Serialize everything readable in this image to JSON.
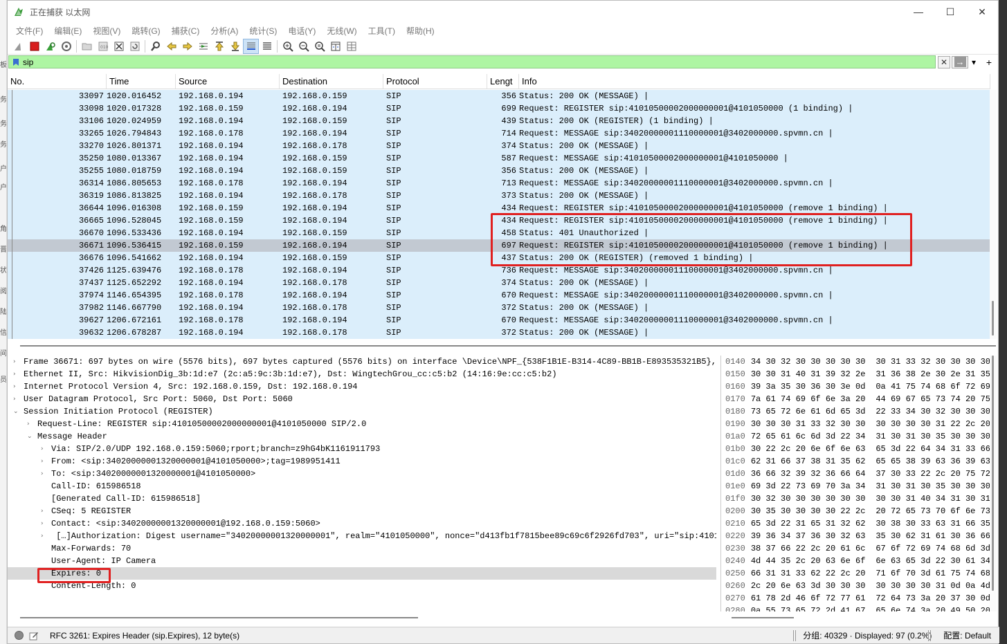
{
  "window": {
    "title": "正在捕获 以太网",
    "minimize": "—",
    "maximize": "☐",
    "close": "✕"
  },
  "menu": [
    "文件(F)",
    "编辑(E)",
    "视图(V)",
    "跳转(G)",
    "捕获(C)",
    "分析(A)",
    "统计(S)",
    "电话(Y)",
    "无线(W)",
    "工具(T)",
    "帮助(H)"
  ],
  "toolbar_icons": [
    "shark-fin-start-icon",
    "stop-icon",
    "restart-icon",
    "options-icon",
    "open-file-icon",
    "save-icon",
    "close-file-icon",
    "reload-icon",
    "find-icon",
    "back-icon",
    "forward-icon",
    "goto-icon",
    "first-icon",
    "last-icon",
    "autoscroll-icon",
    "colorize-icon",
    "zoom-in-icon",
    "zoom-out-icon",
    "zoom-normal-icon",
    "resize-columns-icon",
    "layout-icon"
  ],
  "filter": {
    "value": "sip",
    "clear": "✕",
    "apply": "→",
    "dropdown": "▾",
    "add": "+"
  },
  "packet_columns": [
    "No.",
    "Time",
    "Source",
    "Destination",
    "Protocol",
    "Lengt",
    "Info"
  ],
  "packets": [
    {
      "no": "33097",
      "time": "1020.016452",
      "src": "192.168.0.194",
      "dst": "192.168.0.159",
      "proto": "SIP",
      "len": "356",
      "info": "Status: 200 OK (MESSAGE) |"
    },
    {
      "no": "33098",
      "time": "1020.017328",
      "src": "192.168.0.159",
      "dst": "192.168.0.194",
      "proto": "SIP",
      "len": "699",
      "info": "Request: REGISTER sip:41010500002000000001@4101050000  (1 binding) |"
    },
    {
      "no": "33106",
      "time": "1020.024959",
      "src": "192.168.0.194",
      "dst": "192.168.0.159",
      "proto": "SIP",
      "len": "439",
      "info": "Status: 200 OK (REGISTER)  (1 binding) |"
    },
    {
      "no": "33265",
      "time": "1026.794843",
      "src": "192.168.0.178",
      "dst": "192.168.0.194",
      "proto": "SIP",
      "len": "714",
      "info": "Request: MESSAGE sip:34020000001110000001@3402000000.spvmn.cn |"
    },
    {
      "no": "33270",
      "time": "1026.801371",
      "src": "192.168.0.194",
      "dst": "192.168.0.178",
      "proto": "SIP",
      "len": "374",
      "info": "Status: 200 OK (MESSAGE) |"
    },
    {
      "no": "35250",
      "time": "1080.013367",
      "src": "192.168.0.194",
      "dst": "192.168.0.159",
      "proto": "SIP",
      "len": "587",
      "info": "Request: MESSAGE sip:41010500002000000001@4101050000 |"
    },
    {
      "no": "35255",
      "time": "1080.018759",
      "src": "192.168.0.194",
      "dst": "192.168.0.159",
      "proto": "SIP",
      "len": "356",
      "info": "Status: 200 OK (MESSAGE) |"
    },
    {
      "no": "36314",
      "time": "1086.805653",
      "src": "192.168.0.178",
      "dst": "192.168.0.194",
      "proto": "SIP",
      "len": "713",
      "info": "Request: MESSAGE sip:34020000001110000001@3402000000.spvmn.cn |"
    },
    {
      "no": "36319",
      "time": "1086.813825",
      "src": "192.168.0.194",
      "dst": "192.168.0.178",
      "proto": "SIP",
      "len": "373",
      "info": "Status: 200 OK (MESSAGE) |"
    },
    {
      "no": "36644",
      "time": "1096.016308",
      "src": "192.168.0.159",
      "dst": "192.168.0.194",
      "proto": "SIP",
      "len": "434",
      "info": "Request: REGISTER sip:41010500002000000001@4101050000  (remove 1 binding) |"
    },
    {
      "no": "36665",
      "time": "1096.528045",
      "src": "192.168.0.159",
      "dst": "192.168.0.194",
      "proto": "SIP",
      "len": "434",
      "info": "Request: REGISTER sip:41010500002000000001@4101050000  (remove 1 binding) |"
    },
    {
      "no": "36670",
      "time": "1096.533436",
      "src": "192.168.0.194",
      "dst": "192.168.0.159",
      "proto": "SIP",
      "len": "458",
      "info": "Status: 401 Unauthorized |"
    },
    {
      "no": "36671",
      "time": "1096.536415",
      "src": "192.168.0.159",
      "dst": "192.168.0.194",
      "proto": "SIP",
      "len": "697",
      "info": "Request: REGISTER sip:41010500002000000001@4101050000  (remove 1 binding) |",
      "selected": true
    },
    {
      "no": "36676",
      "time": "1096.541662",
      "src": "192.168.0.194",
      "dst": "192.168.0.159",
      "proto": "SIP",
      "len": "437",
      "info": "Status: 200 OK (REGISTER)  (removed 1 binding) |"
    },
    {
      "no": "37426",
      "time": "1125.639476",
      "src": "192.168.0.178",
      "dst": "192.168.0.194",
      "proto": "SIP",
      "len": "736",
      "info": "Request: MESSAGE sip:34020000001110000001@3402000000.spvmn.cn |"
    },
    {
      "no": "37437",
      "time": "1125.652292",
      "src": "192.168.0.194",
      "dst": "192.168.0.178",
      "proto": "SIP",
      "len": "374",
      "info": "Status: 200 OK (MESSAGE) |"
    },
    {
      "no": "37974",
      "time": "1146.654395",
      "src": "192.168.0.178",
      "dst": "192.168.0.194",
      "proto": "SIP",
      "len": "670",
      "info": "Request: MESSAGE sip:34020000001110000001@3402000000.spvmn.cn |"
    },
    {
      "no": "37982",
      "time": "1146.667790",
      "src": "192.168.0.194",
      "dst": "192.168.0.178",
      "proto": "SIP",
      "len": "372",
      "info": "Status: 200 OK (MESSAGE) |"
    },
    {
      "no": "39627",
      "time": "1206.672161",
      "src": "192.168.0.178",
      "dst": "192.168.0.194",
      "proto": "SIP",
      "len": "670",
      "info": "Request: MESSAGE sip:34020000001110000001@3402000000.spvmn.cn |"
    },
    {
      "no": "39632",
      "time": "1206.678287",
      "src": "192.168.0.194",
      "dst": "192.168.0.178",
      "proto": "SIP",
      "len": "372",
      "info": "Status: 200 OK (MESSAGE) |"
    }
  ],
  "details": [
    {
      "level": 0,
      "arrow": "›",
      "text": "Frame 36671: 697 bytes on wire (5576 bits), 697 bytes captured (5576 bits) on interface \\Device\\NPF_{538F1B1E-B314-4C89-BB1B-E893535321B5},"
    },
    {
      "level": 0,
      "arrow": "›",
      "text": "Ethernet II, Src: HikvisionDig_3b:1d:e7 (2c:a5:9c:3b:1d:e7), Dst: WingtechGrou_cc:c5:b2 (14:16:9e:cc:c5:b2)"
    },
    {
      "level": 0,
      "arrow": "›",
      "text": "Internet Protocol Version 4, Src: 192.168.0.159, Dst: 192.168.0.194"
    },
    {
      "level": 0,
      "arrow": "›",
      "text": "User Datagram Protocol, Src Port: 5060, Dst Port: 5060"
    },
    {
      "level": 0,
      "arrow": "⌄",
      "text": "Session Initiation Protocol (REGISTER)"
    },
    {
      "level": 1,
      "arrow": "›",
      "text": "Request-Line: REGISTER sip:41010500002000000001@4101050000 SIP/2.0"
    },
    {
      "level": 1,
      "arrow": "⌄",
      "text": "Message Header"
    },
    {
      "level": 2,
      "arrow": "›",
      "text": "Via: SIP/2.0/UDP 192.168.0.159:5060;rport;branch=z9hG4bK1161911793"
    },
    {
      "level": 2,
      "arrow": "›",
      "text": "From: <sip:34020000001320000001@4101050000>;tag=1989951411"
    },
    {
      "level": 2,
      "arrow": "›",
      "text": "To: <sip:34020000001320000001@4101050000>"
    },
    {
      "level": 2,
      "arrow": "",
      "text": "Call-ID: 615986518"
    },
    {
      "level": 2,
      "arrow": "",
      "text": "[Generated Call-ID: 615986518]"
    },
    {
      "level": 2,
      "arrow": "›",
      "text": "CSeq: 5 REGISTER"
    },
    {
      "level": 2,
      "arrow": "›",
      "text": "Contact: <sip:34020000001320000001@192.168.0.159:5060>"
    },
    {
      "level": 2,
      "arrow": "›",
      "text": " […]Authorization: Digest username=\"34020000001320000001\", realm=\"4101050000\", nonce=\"d413fb1f7815bee89c69c6f2926fd703\", uri=\"sip:41010"
    },
    {
      "level": 2,
      "arrow": "",
      "text": "Max-Forwards: 70"
    },
    {
      "level": 2,
      "arrow": "",
      "text": "User-Agent: IP Camera"
    },
    {
      "level": 2,
      "arrow": "",
      "text": "Expires: 0",
      "selected": true
    },
    {
      "level": 2,
      "arrow": "",
      "text": "Content-Length: 0"
    }
  ],
  "hex": [
    {
      "off": "0140",
      "a": "34 30 32 30 30 30 30 30",
      "b": "30 31 33 32 30 30 30 30"
    },
    {
      "off": "0150",
      "a": "30 30 31 40 31 39 32 2e",
      "b": "31 36 38 2e 30 2e 31 35"
    },
    {
      "off": "0160",
      "a": "39 3a 35 30 36 30 3e 0d",
      "b": "0a 41 75 74 68 6f 72 69"
    },
    {
      "off": "0170",
      "a": "7a 61 74 69 6f 6e 3a 20",
      "b": "44 69 67 65 73 74 20 75"
    },
    {
      "off": "0180",
      "a": "73 65 72 6e 61 6d 65 3d",
      "b": "22 33 34 30 32 30 30 30"
    },
    {
      "off": "0190",
      "a": "30 30 30 31 33 32 30 30",
      "b": "30 30 30 30 31 22 2c 20"
    },
    {
      "off": "01a0",
      "a": "72 65 61 6c 6d 3d 22 34",
      "b": "31 30 31 30 35 30 30 30"
    },
    {
      "off": "01b0",
      "a": "30 22 2c 20 6e 6f 6e 63",
      "b": "65 3d 22 64 34 31 33 66"
    },
    {
      "off": "01c0",
      "a": "62 31 66 37 38 31 35 62",
      "b": "65 65 38 39 63 36 39 63"
    },
    {
      "off": "01d0",
      "a": "36 66 32 39 32 36 66 64",
      "b": "37 30 33 22 2c 20 75 72"
    },
    {
      "off": "01e0",
      "a": "69 3d 22 73 69 70 3a 34",
      "b": "31 30 31 30 35 30 30 30"
    },
    {
      "off": "01f0",
      "a": "30 32 30 30 30 30 30 30",
      "b": "30 30 31 40 34 31 30 31"
    },
    {
      "off": "0200",
      "a": "30 35 30 30 30 30 22 2c",
      "b": "20 72 65 73 70 6f 6e 73"
    },
    {
      "off": "0210",
      "a": "65 3d 22 31 65 31 32 62",
      "b": "30 38 30 33 63 31 66 35"
    },
    {
      "off": "0220",
      "a": "39 36 34 37 36 30 32 63",
      "b": "35 30 62 31 61 30 36 66"
    },
    {
      "off": "0230",
      "a": "38 37 66 22 2c 20 61 6c",
      "b": "67 6f 72 69 74 68 6d 3d"
    },
    {
      "off": "0240",
      "a": "4d 44 35 2c 20 63 6e 6f",
      "b": "6e 63 65 3d 22 30 61 34"
    },
    {
      "off": "0250",
      "a": "66 31 31 33 62 22 2c 20",
      "b": "71 6f 70 3d 61 75 74 68"
    },
    {
      "off": "0260",
      "a": "2c 20 6e 63 3d 30 30 30",
      "b": "30 30 30 30 31 0d 0a 4d"
    },
    {
      "off": "0270",
      "a": "61 78 2d 46 6f 72 77 61",
      "b": "72 64 73 3a 20 37 30 0d"
    },
    {
      "off": "0280",
      "a": "0a 55 73 65 72 2d 41 67",
      "b": "65 6e 74 3a 20 49 50 20"
    },
    {
      "off": "0290",
      "a": "43 61 6d 65 72 61 0d 0a",
      "b": "45 78 70 69 72 65 73 3a"
    },
    {
      "off": "02a0",
      "a": "20 30 0d 0a 43 6f 6e 74",
      "b": "65 6e 74 2d 4c 65 6e 67"
    },
    {
      "off": "02b0",
      "a": "74 68 3a 20 30 0d 0a 0d",
      "b": "0a"
    }
  ],
  "status": {
    "field_text": "RFC 3261: Expires Header (sip.Expires), 12 byte(s)",
    "packets_text": "分组: 40329 · Displayed: 97 (0.2%)",
    "profile_text": "配置: Default"
  },
  "left_strip_chars": [
    "板",
    "务",
    "务",
    "务",
    "户",
    "户",
    "角",
    "晋",
    "状",
    "阅",
    "陆",
    "信",
    "间",
    "员"
  ],
  "colors": {
    "row_bg": "#dbeefb",
    "row_selected": "#c2c9d2",
    "filter_bg": "#aef5a3",
    "highlight_box": "#e02020"
  }
}
